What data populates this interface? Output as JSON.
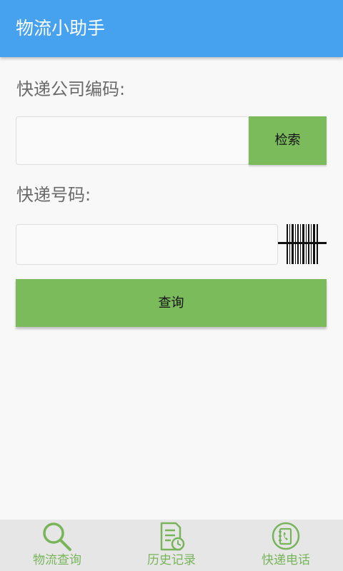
{
  "app_bar": {
    "title": "物流小助手",
    "color": "#46a2ef"
  },
  "form": {
    "company_label": "快递公司编码:",
    "company_value": "",
    "search_button": "检索",
    "number_label": "快递号码:",
    "number_value": "",
    "query_button": "查询",
    "accent_color": "#7cbb5c"
  },
  "bottom_nav": {
    "items": [
      {
        "label": "物流查询",
        "icon": "search-icon"
      },
      {
        "label": "历史记录",
        "icon": "history-record-icon"
      },
      {
        "label": "快递电话",
        "icon": "phone-book-icon"
      }
    ],
    "color": "#78b55a"
  }
}
